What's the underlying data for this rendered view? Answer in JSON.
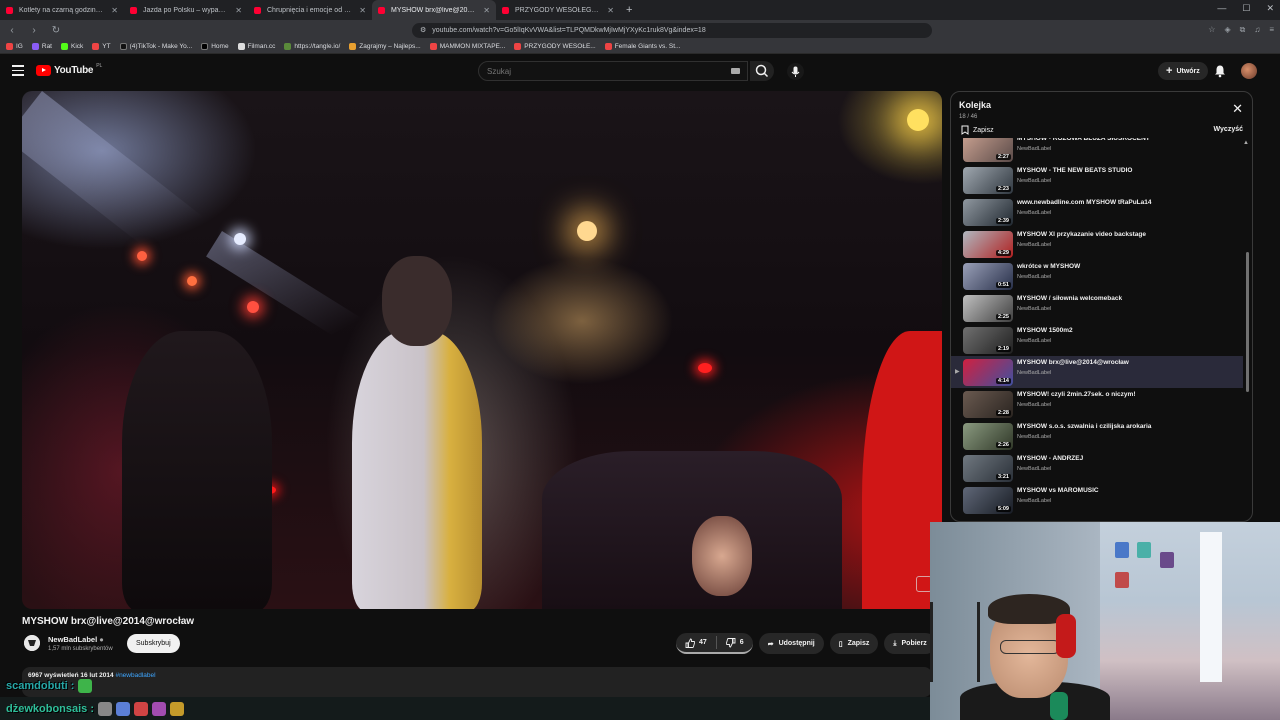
{
  "browser": {
    "tabs": [
      {
        "title": "Kotlety na czarną godzinę - mogą st...",
        "active": false
      },
      {
        "title": "Jazda po Polsku – wypadki i kolizje d...",
        "active": false
      },
      {
        "title": "Chrupnięcia i emocje od Poliny 😊 -",
        "active": false
      },
      {
        "title": "MYSHOW brx@live@2014@...",
        "active": true
      },
      {
        "title": "PRZYGODY WESOŁEGO MAZURA wa...",
        "active": false
      }
    ],
    "new_tab": "+",
    "url": "youtube.com/watch?v=Go5lIqKvVWA&list=TLPQMDkwMjIwMjYXyKc1ruk8Vg&index=18",
    "bookmarks": [
      "IG",
      "Rat",
      "Kick",
      "YT",
      "(4)TikTok - Make Yo...",
      "Home",
      "Filman.cc",
      "https://tangle.io/",
      "Zagrajmy – Najleps...",
      "MAMMON MIXTAPE...",
      "PRZYGODY WESOŁE...",
      "Female Giants vs. St..."
    ]
  },
  "youtube": {
    "logo": "YouTube",
    "logo_region": "PL",
    "search_placeholder": "Szukaj",
    "create_label": "Utwórz"
  },
  "video": {
    "title": "MYSHOW brx@live@2014@wrocław",
    "channel": "NewBadLabel",
    "subscribers": "1,57 mln subskrybentów",
    "subscribe_label": "Subskrybuj",
    "likes": "47",
    "dislikes": "6",
    "share_label": "Udostępnij",
    "save_label": "Zapisz",
    "download_label": "Pobierz",
    "views_date": "6967 wyświetleń  16 lut 2014",
    "hashtag": "#newbadlabel"
  },
  "queue": {
    "title": "Kolejka",
    "count": "18 / 46",
    "save_label": "Zapisz",
    "clear_label": "Wyczyść",
    "items": [
      {
        "title": "MYSHOW - RÓŻOWA BLUZA SIUŚROCENT",
        "channel": "NewBadLabel",
        "duration": "2:27",
        "current": false
      },
      {
        "title": "MYSHOW - THE NEW BEATS STUDIO",
        "channel": "NewBadLabel",
        "duration": "2:23",
        "current": false
      },
      {
        "title": "www.newbadline.com MYSHOW tRaPuLa14",
        "channel": "NewBadLabel",
        "duration": "2:39",
        "current": false
      },
      {
        "title": "MYSHOW XI przykazanie video backstage",
        "channel": "NewBadLabel",
        "duration": "4:29",
        "current": false
      },
      {
        "title": "wkrótce w MYSHOW",
        "channel": "NewBadLabel",
        "duration": "0:51",
        "current": false
      },
      {
        "title": "MYSHOW / siłownia welcomeback",
        "channel": "NewBadLabel",
        "duration": "2:25",
        "current": false
      },
      {
        "title": "MYSHOW 1500m2",
        "channel": "NewBadLabel",
        "duration": "2:19",
        "current": false
      },
      {
        "title": "MYSHOW brx@live@2014@wrocław",
        "channel": "NewBadLabel",
        "duration": "4:14",
        "current": true
      },
      {
        "title": "MYSHOW! czyli 2min.27sek. o niczym!",
        "channel": "NewBadLabel",
        "duration": "2:28",
        "current": false
      },
      {
        "title": "MYSHOW s.o.s. szwalnia i czilijska arokaria",
        "channel": "NewBadLabel",
        "duration": "2:26",
        "current": false
      },
      {
        "title": "MYSHOW - ANDRZEJ",
        "channel": "NewBadLabel",
        "duration": "3:21",
        "current": false
      },
      {
        "title": "MYSHOW vs MAROMUSIC",
        "channel": "NewBadLabel",
        "duration": "5:09",
        "current": false
      }
    ]
  },
  "chat": {
    "line1_user": "scamdobuti :",
    "line2_user": "dżewkobonsais :"
  }
}
